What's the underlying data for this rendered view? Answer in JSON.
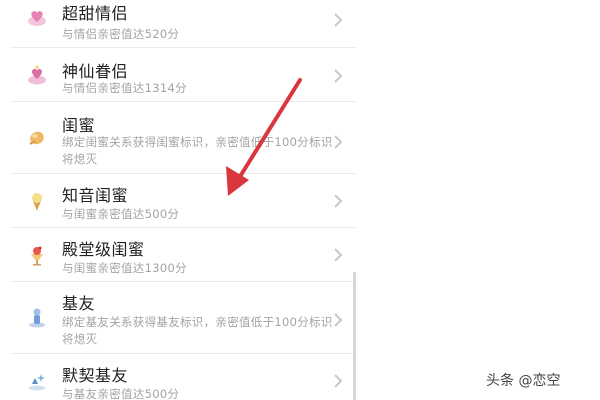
{
  "items": [
    {
      "title": "超甜情侣",
      "desc": "与情侣亲密值达520分",
      "icon": "couple-heart-icon"
    },
    {
      "title": "神仙眷侣",
      "desc": "与情侣亲密值达1314分",
      "icon": "immortal-couple-icon"
    },
    {
      "title": "闺蜜",
      "desc": "绑定闺蜜关系获得闺蜜标识，亲密值低于100分标识将熄灭",
      "icon": "bestie-icon"
    },
    {
      "title": "知音闺蜜",
      "desc": "与闺蜜亲密值达500分",
      "icon": "ice-cream-icon"
    },
    {
      "title": "殿堂级闺蜜",
      "desc": "与闺蜜亲密值达1300分",
      "icon": "sundae-icon"
    },
    {
      "title": "基友",
      "desc": "绑定基友关系获得基友标识，亲密值低于100分标识将熄灭",
      "icon": "buddy-icon"
    },
    {
      "title": "默契基友",
      "desc": "与基友亲密值达500分",
      "icon": "sparkle-buddy-icon"
    }
  ],
  "watermark": "头条 @恋空",
  "colors": {
    "title": "#222222",
    "desc": "#a3a3a3",
    "arrow": "#d9363e",
    "chevron": "#c8c8c8"
  }
}
